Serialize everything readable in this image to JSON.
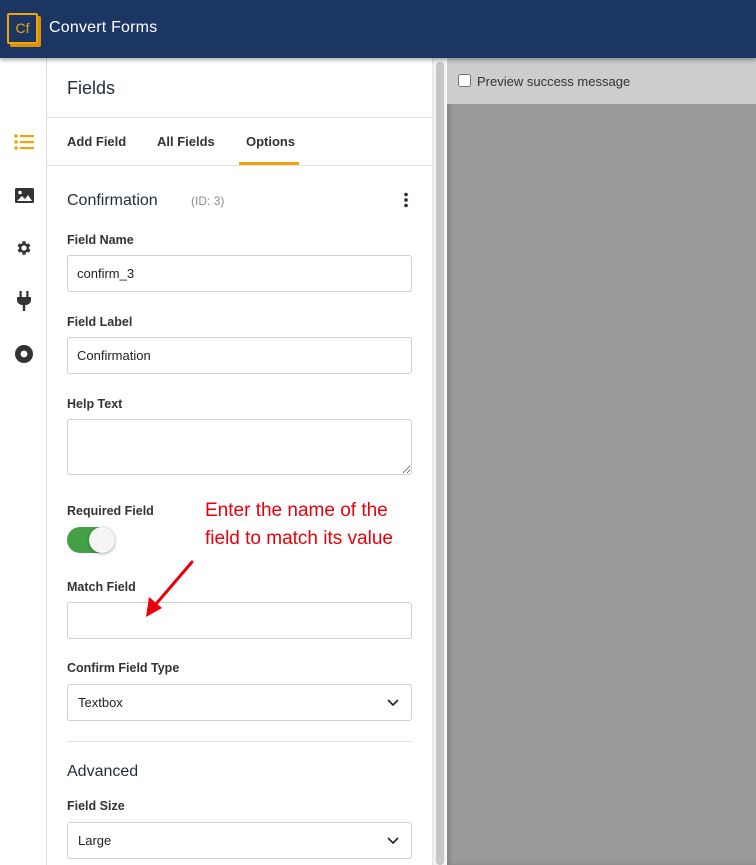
{
  "header": {
    "logo_text": "Cf",
    "app_name": "Convert Forms"
  },
  "sidebar": {
    "items": [
      {
        "icon": "list-icon",
        "active": true
      },
      {
        "icon": "image-icon",
        "active": false
      },
      {
        "icon": "gear-icon",
        "active": false
      },
      {
        "icon": "plug-icon",
        "active": false
      },
      {
        "icon": "record-icon",
        "active": false
      }
    ]
  },
  "panel": {
    "title": "Fields",
    "tabs": [
      {
        "label": "Add Field",
        "active": false
      },
      {
        "label": "All Fields",
        "active": false
      },
      {
        "label": "Options",
        "active": true
      }
    ]
  },
  "field": {
    "type": "Confirmation",
    "id_label": "(ID: 3)"
  },
  "form": {
    "field_name": {
      "label": "Field Name",
      "value": "confirm_3"
    },
    "field_label": {
      "label": "Field Label",
      "value": "Confirmation"
    },
    "help_text": {
      "label": "Help Text",
      "value": ""
    },
    "required": {
      "label": "Required Field",
      "checked": true
    },
    "match_field": {
      "label": "Match Field",
      "value": ""
    },
    "confirm_type": {
      "label": "Confirm Field Type",
      "value": "Textbox"
    }
  },
  "advanced": {
    "heading": "Advanced",
    "field_size": {
      "label": "Field Size",
      "value": "Large"
    }
  },
  "preview": {
    "checkbox_label": "Preview success message",
    "checked": false
  },
  "annotation": {
    "line1": "Enter the name of the",
    "line2": "field to match its value"
  },
  "colors": {
    "header_bg": "#1c3664",
    "accent": "#f0a30a",
    "toggle_on": "#43a047",
    "annotation_red": "#e8000b"
  }
}
